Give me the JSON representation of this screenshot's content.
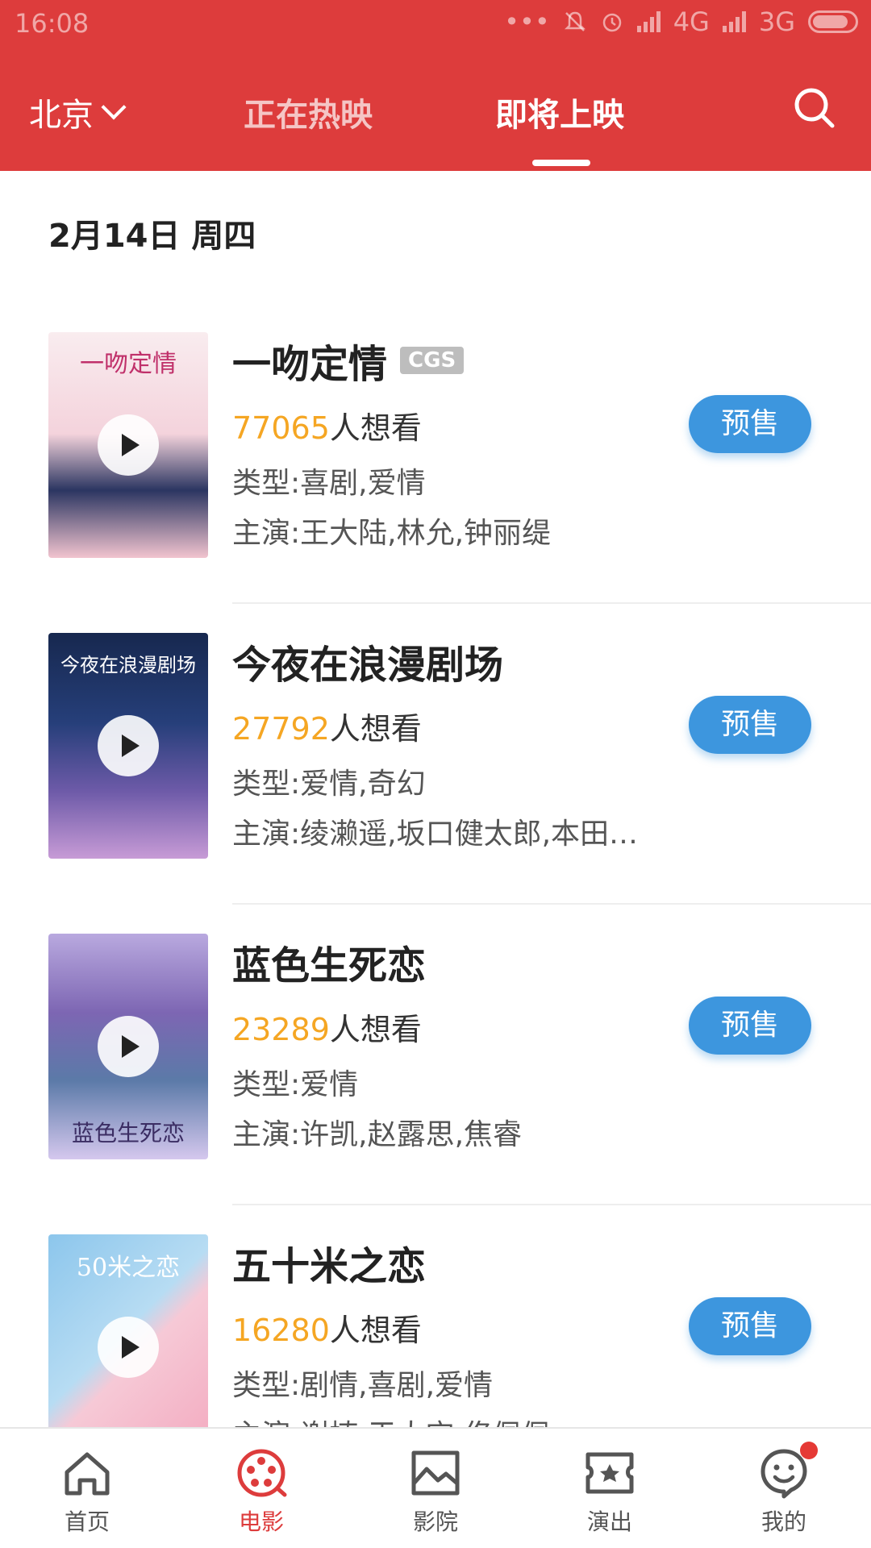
{
  "status_bar": {
    "time": "16:08",
    "network_4g": "4G",
    "network_3g": "3G"
  },
  "header": {
    "city": "北京",
    "tabs": [
      {
        "label": "正在热映",
        "active": false
      },
      {
        "label": "即将上映",
        "active": true
      }
    ]
  },
  "section": {
    "date": "2月14日 周四"
  },
  "movies": [
    {
      "title": "一吻定情",
      "badge": "CGS",
      "want_count": "77065",
      "want_suffix": "人想看",
      "genre": "类型:喜剧,爱情",
      "cast": "主演:王大陆,林允,钟丽缇",
      "button": "预售",
      "poster_text": "一吻定情",
      "poster_colors": [
        "#f7e3e8",
        "#1f2a4f"
      ]
    },
    {
      "title": "今夜在浪漫剧场",
      "badge": "",
      "want_count": "27792",
      "want_suffix": "人想看",
      "genre": "类型:爱情,奇幻",
      "cast": "主演:绫濑遥,坂口健太郎,本田…",
      "button": "预售",
      "poster_text": "今夜在浪漫剧场",
      "poster_colors": [
        "#1c2f5e",
        "#9a6fc0"
      ]
    },
    {
      "title": "蓝色生死恋",
      "badge": "",
      "want_count": "23289",
      "want_suffix": "人想看",
      "genre": "类型:爱情",
      "cast": "主演:许凯,赵露思,焦睿",
      "button": "预售",
      "poster_text": "蓝色生死恋",
      "poster_colors": [
        "#6d5aa8",
        "#c7b7e6"
      ]
    },
    {
      "title": "五十米之恋",
      "badge": "",
      "want_count": "16280",
      "want_suffix": "人想看",
      "genre": "类型:剧情,喜剧,爱情",
      "cast": "主演:谢楠,于大宝,佟佩佩",
      "button": "预售",
      "poster_text": "50米之恋",
      "poster_colors": [
        "#8cc6ec",
        "#f6c9d6"
      ]
    }
  ],
  "bottom_nav": [
    {
      "label": "首页",
      "icon": "home-icon",
      "active": false
    },
    {
      "label": "电影",
      "icon": "film-reel-icon",
      "active": true
    },
    {
      "label": "影院",
      "icon": "cinema-icon",
      "active": false
    },
    {
      "label": "演出",
      "icon": "ticket-star-icon",
      "active": false
    },
    {
      "label": "我的",
      "icon": "profile-icon",
      "active": false,
      "notification": true
    }
  ],
  "colors": {
    "brand_red": "#dd3c3c",
    "presale_blue": "#3d96de",
    "want_count_orange": "#f5a623"
  }
}
